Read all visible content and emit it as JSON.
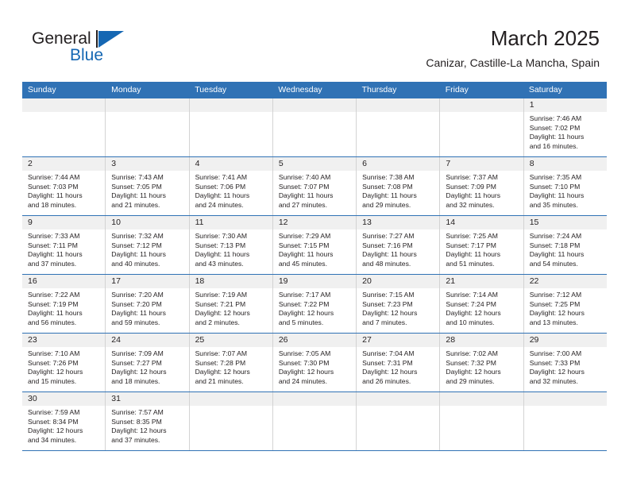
{
  "brand": {
    "word_one": "General",
    "word_two": "Blue",
    "logo_icon": "blue-flag-triangle-icon",
    "accent_color": "#1567b3"
  },
  "header": {
    "title": "March 2025",
    "subtitle": "Canizar, Castille-La Mancha, Spain"
  },
  "theme": {
    "header_bg": "#3072b5",
    "header_text": "#ffffff",
    "daynum_band_bg": "#f0f0f0",
    "row_divider": "#3072b5",
    "cell_divider": "#d3d3d3",
    "text": "#231f20"
  },
  "weekdays": [
    "Sunday",
    "Monday",
    "Tuesday",
    "Wednesday",
    "Thursday",
    "Friday",
    "Saturday"
  ],
  "labels": {
    "sunrise_prefix": "Sunrise:",
    "sunset_prefix": "Sunset:",
    "daylight_prefix": "Daylight:"
  },
  "weeks": [
    [
      {
        "empty": true
      },
      {
        "empty": true
      },
      {
        "empty": true
      },
      {
        "empty": true
      },
      {
        "empty": true
      },
      {
        "empty": true
      },
      {
        "day": "1",
        "sunrise": "Sunrise: 7:46 AM",
        "sunset": "Sunset: 7:02 PM",
        "daylight_1": "Daylight: 11 hours",
        "daylight_2": "and 16 minutes."
      }
    ],
    [
      {
        "day": "2",
        "sunrise": "Sunrise: 7:44 AM",
        "sunset": "Sunset: 7:03 PM",
        "daylight_1": "Daylight: 11 hours",
        "daylight_2": "and 18 minutes."
      },
      {
        "day": "3",
        "sunrise": "Sunrise: 7:43 AM",
        "sunset": "Sunset: 7:05 PM",
        "daylight_1": "Daylight: 11 hours",
        "daylight_2": "and 21 minutes."
      },
      {
        "day": "4",
        "sunrise": "Sunrise: 7:41 AM",
        "sunset": "Sunset: 7:06 PM",
        "daylight_1": "Daylight: 11 hours",
        "daylight_2": "and 24 minutes."
      },
      {
        "day": "5",
        "sunrise": "Sunrise: 7:40 AM",
        "sunset": "Sunset: 7:07 PM",
        "daylight_1": "Daylight: 11 hours",
        "daylight_2": "and 27 minutes."
      },
      {
        "day": "6",
        "sunrise": "Sunrise: 7:38 AM",
        "sunset": "Sunset: 7:08 PM",
        "daylight_1": "Daylight: 11 hours",
        "daylight_2": "and 29 minutes."
      },
      {
        "day": "7",
        "sunrise": "Sunrise: 7:37 AM",
        "sunset": "Sunset: 7:09 PM",
        "daylight_1": "Daylight: 11 hours",
        "daylight_2": "and 32 minutes."
      },
      {
        "day": "8",
        "sunrise": "Sunrise: 7:35 AM",
        "sunset": "Sunset: 7:10 PM",
        "daylight_1": "Daylight: 11 hours",
        "daylight_2": "and 35 minutes."
      }
    ],
    [
      {
        "day": "9",
        "sunrise": "Sunrise: 7:33 AM",
        "sunset": "Sunset: 7:11 PM",
        "daylight_1": "Daylight: 11 hours",
        "daylight_2": "and 37 minutes."
      },
      {
        "day": "10",
        "sunrise": "Sunrise: 7:32 AM",
        "sunset": "Sunset: 7:12 PM",
        "daylight_1": "Daylight: 11 hours",
        "daylight_2": "and 40 minutes."
      },
      {
        "day": "11",
        "sunrise": "Sunrise: 7:30 AM",
        "sunset": "Sunset: 7:13 PM",
        "daylight_1": "Daylight: 11 hours",
        "daylight_2": "and 43 minutes."
      },
      {
        "day": "12",
        "sunrise": "Sunrise: 7:29 AM",
        "sunset": "Sunset: 7:15 PM",
        "daylight_1": "Daylight: 11 hours",
        "daylight_2": "and 45 minutes."
      },
      {
        "day": "13",
        "sunrise": "Sunrise: 7:27 AM",
        "sunset": "Sunset: 7:16 PM",
        "daylight_1": "Daylight: 11 hours",
        "daylight_2": "and 48 minutes."
      },
      {
        "day": "14",
        "sunrise": "Sunrise: 7:25 AM",
        "sunset": "Sunset: 7:17 PM",
        "daylight_1": "Daylight: 11 hours",
        "daylight_2": "and 51 minutes."
      },
      {
        "day": "15",
        "sunrise": "Sunrise: 7:24 AM",
        "sunset": "Sunset: 7:18 PM",
        "daylight_1": "Daylight: 11 hours",
        "daylight_2": "and 54 minutes."
      }
    ],
    [
      {
        "day": "16",
        "sunrise": "Sunrise: 7:22 AM",
        "sunset": "Sunset: 7:19 PM",
        "daylight_1": "Daylight: 11 hours",
        "daylight_2": "and 56 minutes."
      },
      {
        "day": "17",
        "sunrise": "Sunrise: 7:20 AM",
        "sunset": "Sunset: 7:20 PM",
        "daylight_1": "Daylight: 11 hours",
        "daylight_2": "and 59 minutes."
      },
      {
        "day": "18",
        "sunrise": "Sunrise: 7:19 AM",
        "sunset": "Sunset: 7:21 PM",
        "daylight_1": "Daylight: 12 hours",
        "daylight_2": "and 2 minutes."
      },
      {
        "day": "19",
        "sunrise": "Sunrise: 7:17 AM",
        "sunset": "Sunset: 7:22 PM",
        "daylight_1": "Daylight: 12 hours",
        "daylight_2": "and 5 minutes."
      },
      {
        "day": "20",
        "sunrise": "Sunrise: 7:15 AM",
        "sunset": "Sunset: 7:23 PM",
        "daylight_1": "Daylight: 12 hours",
        "daylight_2": "and 7 minutes."
      },
      {
        "day": "21",
        "sunrise": "Sunrise: 7:14 AM",
        "sunset": "Sunset: 7:24 PM",
        "daylight_1": "Daylight: 12 hours",
        "daylight_2": "and 10 minutes."
      },
      {
        "day": "22",
        "sunrise": "Sunrise: 7:12 AM",
        "sunset": "Sunset: 7:25 PM",
        "daylight_1": "Daylight: 12 hours",
        "daylight_2": "and 13 minutes."
      }
    ],
    [
      {
        "day": "23",
        "sunrise": "Sunrise: 7:10 AM",
        "sunset": "Sunset: 7:26 PM",
        "daylight_1": "Daylight: 12 hours",
        "daylight_2": "and 15 minutes."
      },
      {
        "day": "24",
        "sunrise": "Sunrise: 7:09 AM",
        "sunset": "Sunset: 7:27 PM",
        "daylight_1": "Daylight: 12 hours",
        "daylight_2": "and 18 minutes."
      },
      {
        "day": "25",
        "sunrise": "Sunrise: 7:07 AM",
        "sunset": "Sunset: 7:28 PM",
        "daylight_1": "Daylight: 12 hours",
        "daylight_2": "and 21 minutes."
      },
      {
        "day": "26",
        "sunrise": "Sunrise: 7:05 AM",
        "sunset": "Sunset: 7:30 PM",
        "daylight_1": "Daylight: 12 hours",
        "daylight_2": "and 24 minutes."
      },
      {
        "day": "27",
        "sunrise": "Sunrise: 7:04 AM",
        "sunset": "Sunset: 7:31 PM",
        "daylight_1": "Daylight: 12 hours",
        "daylight_2": "and 26 minutes."
      },
      {
        "day": "28",
        "sunrise": "Sunrise: 7:02 AM",
        "sunset": "Sunset: 7:32 PM",
        "daylight_1": "Daylight: 12 hours",
        "daylight_2": "and 29 minutes."
      },
      {
        "day": "29",
        "sunrise": "Sunrise: 7:00 AM",
        "sunset": "Sunset: 7:33 PM",
        "daylight_1": "Daylight: 12 hours",
        "daylight_2": "and 32 minutes."
      }
    ],
    [
      {
        "day": "30",
        "sunrise": "Sunrise: 7:59 AM",
        "sunset": "Sunset: 8:34 PM",
        "daylight_1": "Daylight: 12 hours",
        "daylight_2": "and 34 minutes."
      },
      {
        "day": "31",
        "sunrise": "Sunrise: 7:57 AM",
        "sunset": "Sunset: 8:35 PM",
        "daylight_1": "Daylight: 12 hours",
        "daylight_2": "and 37 minutes."
      },
      {
        "empty": true
      },
      {
        "empty": true
      },
      {
        "empty": true
      },
      {
        "empty": true
      },
      {
        "empty": true
      }
    ]
  ]
}
